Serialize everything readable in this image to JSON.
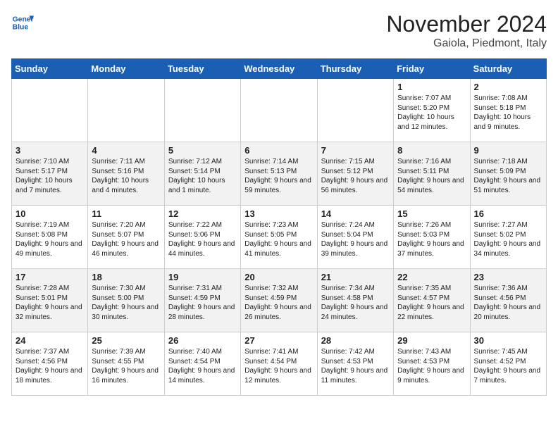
{
  "header": {
    "logo_line1": "General",
    "logo_line2": "Blue",
    "month": "November 2024",
    "location": "Gaiola, Piedmont, Italy"
  },
  "days_of_week": [
    "Sunday",
    "Monday",
    "Tuesday",
    "Wednesday",
    "Thursday",
    "Friday",
    "Saturday"
  ],
  "weeks": [
    [
      {
        "day": "",
        "info": ""
      },
      {
        "day": "",
        "info": ""
      },
      {
        "day": "",
        "info": ""
      },
      {
        "day": "",
        "info": ""
      },
      {
        "day": "",
        "info": ""
      },
      {
        "day": "1",
        "info": "Sunrise: 7:07 AM\nSunset: 5:20 PM\nDaylight: 10 hours and 12 minutes."
      },
      {
        "day": "2",
        "info": "Sunrise: 7:08 AM\nSunset: 5:18 PM\nDaylight: 10 hours and 9 minutes."
      }
    ],
    [
      {
        "day": "3",
        "info": "Sunrise: 7:10 AM\nSunset: 5:17 PM\nDaylight: 10 hours and 7 minutes."
      },
      {
        "day": "4",
        "info": "Sunrise: 7:11 AM\nSunset: 5:16 PM\nDaylight: 10 hours and 4 minutes."
      },
      {
        "day": "5",
        "info": "Sunrise: 7:12 AM\nSunset: 5:14 PM\nDaylight: 10 hours and 1 minute."
      },
      {
        "day": "6",
        "info": "Sunrise: 7:14 AM\nSunset: 5:13 PM\nDaylight: 9 hours and 59 minutes."
      },
      {
        "day": "7",
        "info": "Sunrise: 7:15 AM\nSunset: 5:12 PM\nDaylight: 9 hours and 56 minutes."
      },
      {
        "day": "8",
        "info": "Sunrise: 7:16 AM\nSunset: 5:11 PM\nDaylight: 9 hours and 54 minutes."
      },
      {
        "day": "9",
        "info": "Sunrise: 7:18 AM\nSunset: 5:09 PM\nDaylight: 9 hours and 51 minutes."
      }
    ],
    [
      {
        "day": "10",
        "info": "Sunrise: 7:19 AM\nSunset: 5:08 PM\nDaylight: 9 hours and 49 minutes."
      },
      {
        "day": "11",
        "info": "Sunrise: 7:20 AM\nSunset: 5:07 PM\nDaylight: 9 hours and 46 minutes."
      },
      {
        "day": "12",
        "info": "Sunrise: 7:22 AM\nSunset: 5:06 PM\nDaylight: 9 hours and 44 minutes."
      },
      {
        "day": "13",
        "info": "Sunrise: 7:23 AM\nSunset: 5:05 PM\nDaylight: 9 hours and 41 minutes."
      },
      {
        "day": "14",
        "info": "Sunrise: 7:24 AM\nSunset: 5:04 PM\nDaylight: 9 hours and 39 minutes."
      },
      {
        "day": "15",
        "info": "Sunrise: 7:26 AM\nSunset: 5:03 PM\nDaylight: 9 hours and 37 minutes."
      },
      {
        "day": "16",
        "info": "Sunrise: 7:27 AM\nSunset: 5:02 PM\nDaylight: 9 hours and 34 minutes."
      }
    ],
    [
      {
        "day": "17",
        "info": "Sunrise: 7:28 AM\nSunset: 5:01 PM\nDaylight: 9 hours and 32 minutes."
      },
      {
        "day": "18",
        "info": "Sunrise: 7:30 AM\nSunset: 5:00 PM\nDaylight: 9 hours and 30 minutes."
      },
      {
        "day": "19",
        "info": "Sunrise: 7:31 AM\nSunset: 4:59 PM\nDaylight: 9 hours and 28 minutes."
      },
      {
        "day": "20",
        "info": "Sunrise: 7:32 AM\nSunset: 4:59 PM\nDaylight: 9 hours and 26 minutes."
      },
      {
        "day": "21",
        "info": "Sunrise: 7:34 AM\nSunset: 4:58 PM\nDaylight: 9 hours and 24 minutes."
      },
      {
        "day": "22",
        "info": "Sunrise: 7:35 AM\nSunset: 4:57 PM\nDaylight: 9 hours and 22 minutes."
      },
      {
        "day": "23",
        "info": "Sunrise: 7:36 AM\nSunset: 4:56 PM\nDaylight: 9 hours and 20 minutes."
      }
    ],
    [
      {
        "day": "24",
        "info": "Sunrise: 7:37 AM\nSunset: 4:56 PM\nDaylight: 9 hours and 18 minutes."
      },
      {
        "day": "25",
        "info": "Sunrise: 7:39 AM\nSunset: 4:55 PM\nDaylight: 9 hours and 16 minutes."
      },
      {
        "day": "26",
        "info": "Sunrise: 7:40 AM\nSunset: 4:54 PM\nDaylight: 9 hours and 14 minutes."
      },
      {
        "day": "27",
        "info": "Sunrise: 7:41 AM\nSunset: 4:54 PM\nDaylight: 9 hours and 12 minutes."
      },
      {
        "day": "28",
        "info": "Sunrise: 7:42 AM\nSunset: 4:53 PM\nDaylight: 9 hours and 11 minutes."
      },
      {
        "day": "29",
        "info": "Sunrise: 7:43 AM\nSunset: 4:53 PM\nDaylight: 9 hours and 9 minutes."
      },
      {
        "day": "30",
        "info": "Sunrise: 7:45 AM\nSunset: 4:52 PM\nDaylight: 9 hours and 7 minutes."
      }
    ]
  ]
}
